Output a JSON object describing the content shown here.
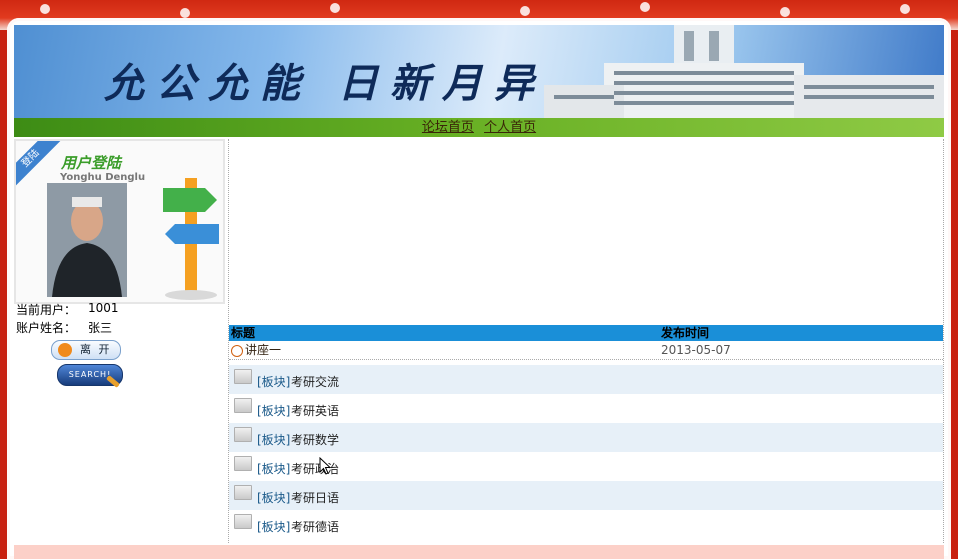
{
  "banner": {
    "title": "允公允能 日新月异"
  },
  "nav": {
    "items": [
      {
        "label": "论坛首页"
      },
      {
        "label": "个人首页"
      }
    ]
  },
  "login": {
    "ribbon": "登陆",
    "title": "用户登陆",
    "subtitle": "Yonghu Denglu",
    "current_user_label": "当前用户：",
    "current_user_value": "1001",
    "account_name_label": "账户姓名：",
    "account_name_value": "张三",
    "leave_button": "离 开",
    "search_button": "SEARCH!"
  },
  "table": {
    "headers": {
      "title": "标题",
      "date": "发布时间"
    },
    "rows": [
      {
        "title": "讲座一",
        "date": "2013-05-07"
      }
    ]
  },
  "boards": [
    {
      "tag": "[板块]",
      "name": "考研交流"
    },
    {
      "tag": "[板块]",
      "name": "考研英语"
    },
    {
      "tag": "[板块]",
      "name": "考研数学"
    },
    {
      "tag": "[板块]",
      "name": "考研政治"
    },
    {
      "tag": "[板块]",
      "name": "考研日语"
    },
    {
      "tag": "[板块]",
      "name": "考研德语"
    }
  ]
}
